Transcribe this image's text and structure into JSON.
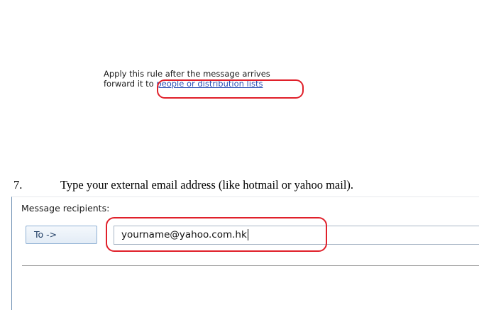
{
  "rule_description": {
    "line1": "Apply this rule after the message arrives",
    "line2_prefix": "forward it to ",
    "line2_link": "people or distribution lists"
  },
  "instruction": {
    "step_number": "7.",
    "text": "Type your external email address (like hotmail or yahoo mail)."
  },
  "recipients_dialog": {
    "label": "Message recipients:",
    "to_button": "To ->",
    "input_value": "yourname@yahoo.com.hk"
  },
  "annotation_color": "#e0202a"
}
